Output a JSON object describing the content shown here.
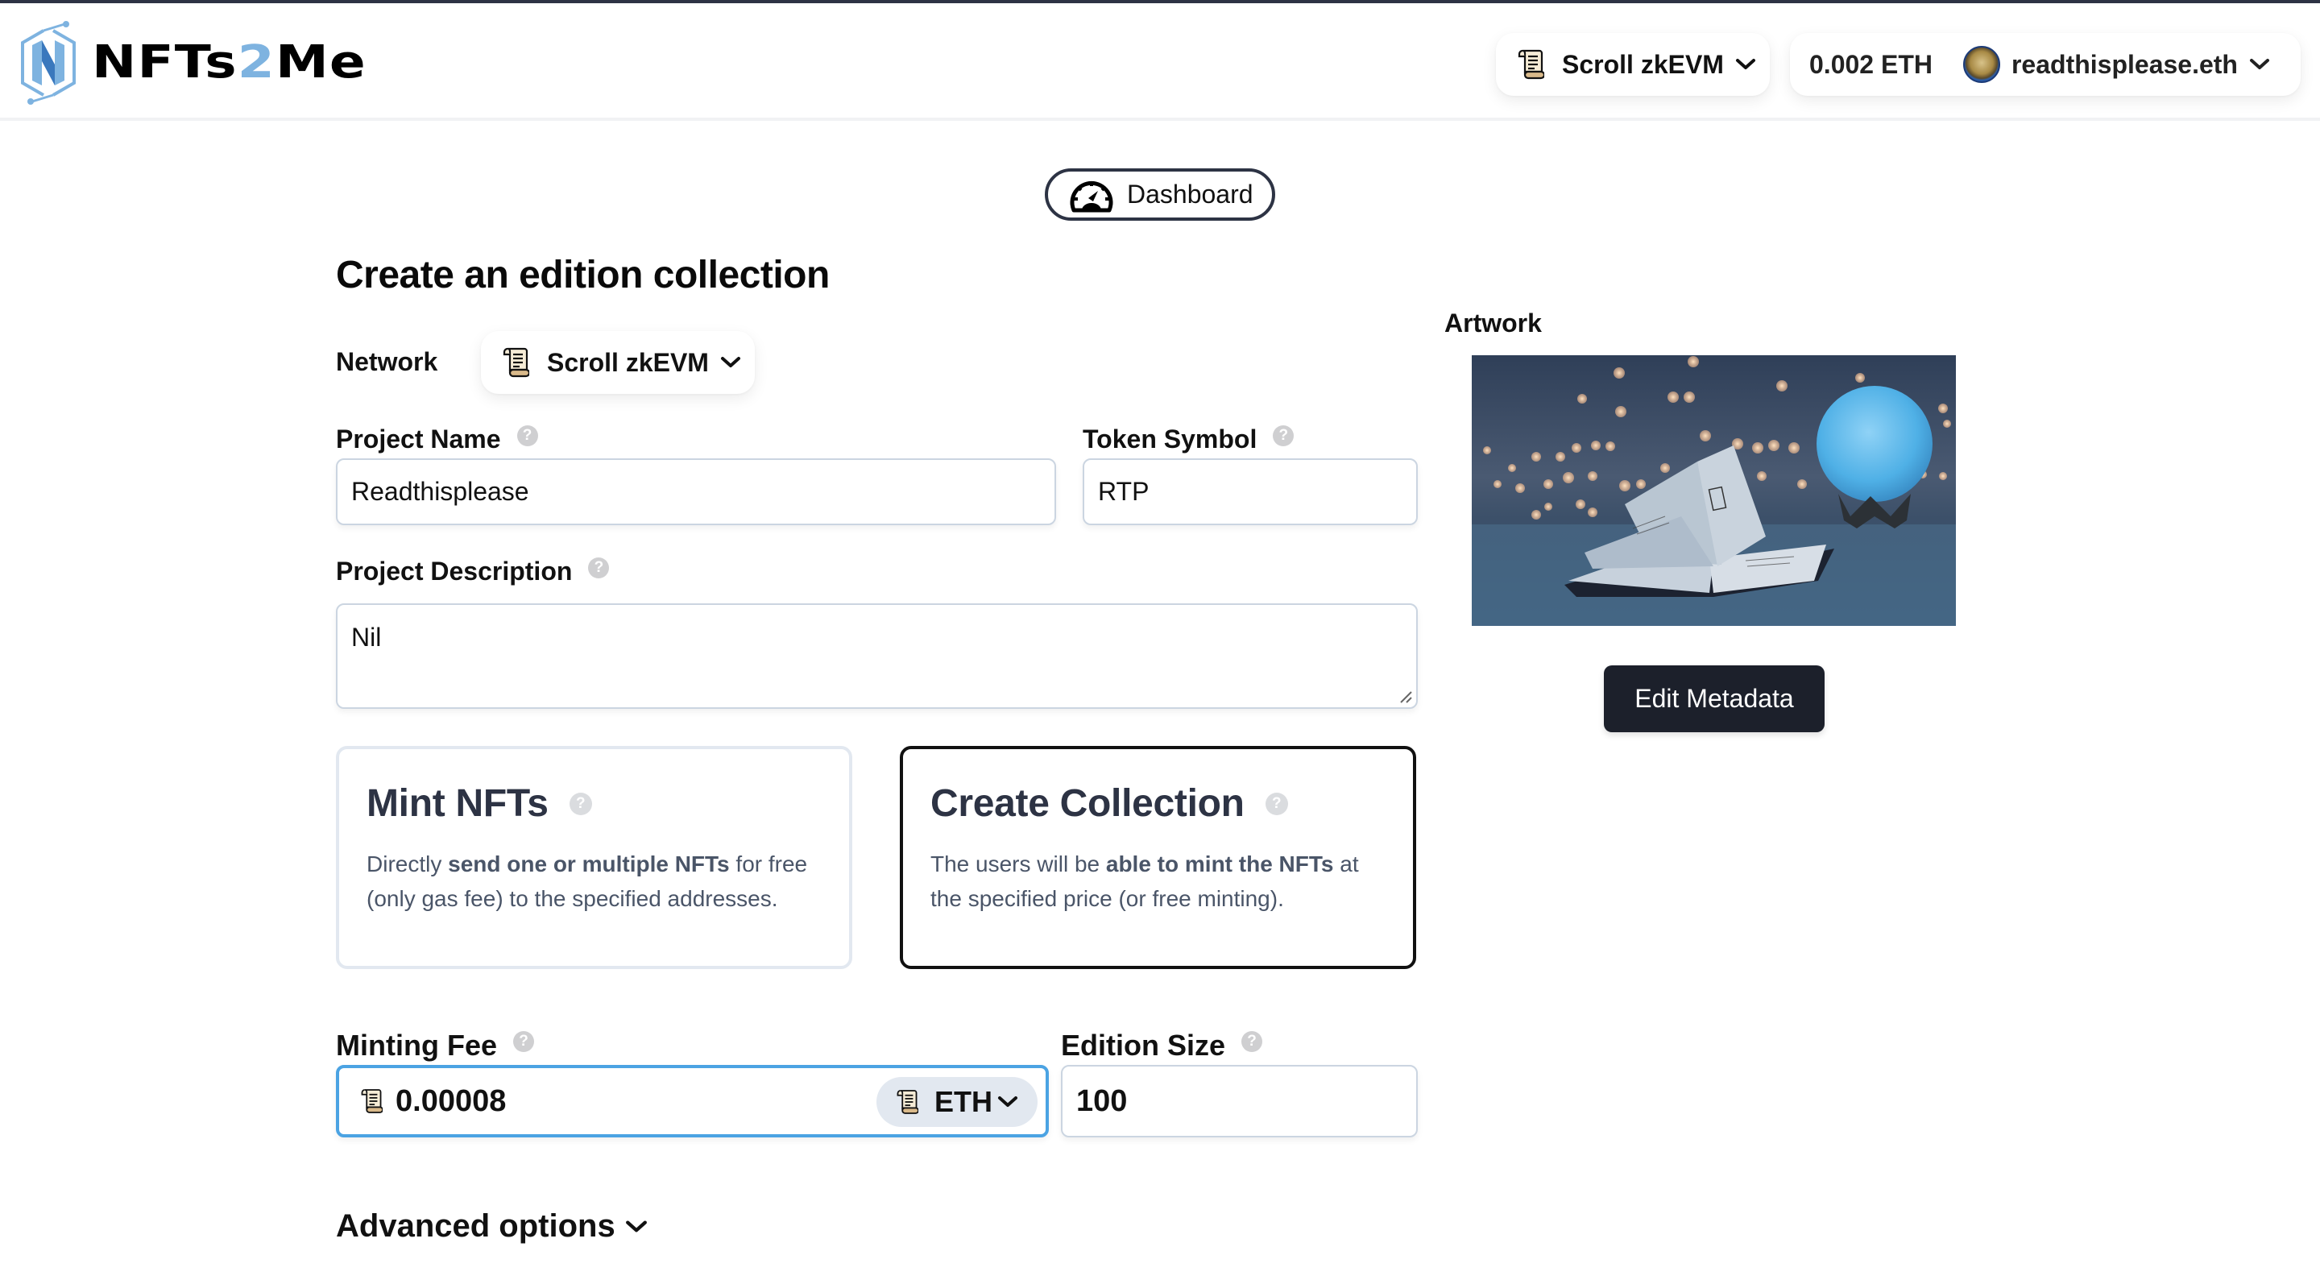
{
  "header": {
    "logo_text_prefix": "NFTs",
    "logo_text_two": "2",
    "logo_text_suffix": "Me",
    "network": {
      "label": "Scroll zkEVM",
      "icon": "scroll-icon"
    },
    "wallet": {
      "balance": "0.002 ETH",
      "username": "readthisplease.eth"
    }
  },
  "dashboard_button": {
    "label": "Dashboard",
    "icon": "dashboard-gauge-icon"
  },
  "page_title": "Create an edition collection",
  "form": {
    "network": {
      "label": "Network",
      "value": "Scroll zkEVM"
    },
    "project_name": {
      "label": "Project Name",
      "value": "Readthisplease"
    },
    "token_symbol": {
      "label": "Token Symbol",
      "value": "RTP"
    },
    "project_description": {
      "label": "Project Description",
      "value": "Nil"
    },
    "mode_cards": [
      {
        "title": "Mint NFTs",
        "desc_pre": "Directly ",
        "desc_bold": "send one or multiple NFTs",
        "desc_post": " for free (only gas fee) to the specified addresses.",
        "selected": false
      },
      {
        "title": "Create Collection",
        "desc_pre": "The users will be ",
        "desc_bold": "able to mint the NFTs",
        "desc_post": " at the specified price (or free minting).",
        "selected": true
      }
    ],
    "minting_fee": {
      "label": "Minting Fee",
      "value": "0.00008",
      "currency": "ETH"
    },
    "edition_size": {
      "label": "Edition Size",
      "value": "100"
    },
    "advanced_options": {
      "label": "Advanced options"
    }
  },
  "artwork": {
    "label": "Artwork",
    "image_description": "open book with glowing blue moon lamp and bokeh lights",
    "edit_button": "Edit Metadata"
  },
  "colors": {
    "accent_blue": "#4ba3e3",
    "logo_light_blue": "#7eb3e0",
    "logo_dark_blue": "#3a78bd",
    "dark_button": "#1c202b",
    "top_border": "#2d3344"
  }
}
